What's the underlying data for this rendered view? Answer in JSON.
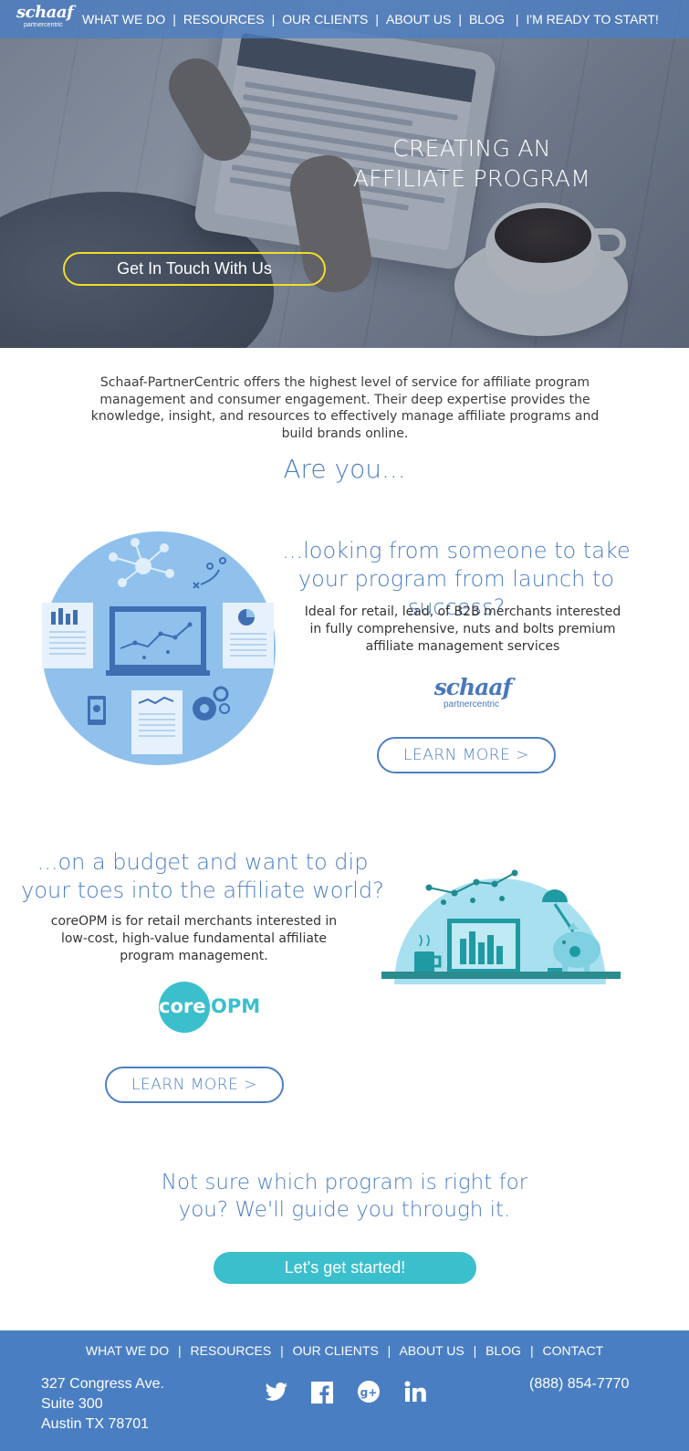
{
  "nav": {
    "logo_word": "schaaf",
    "logo_sub": "partnercentric",
    "items": [
      "WHAT WE DO",
      "RESOURCES",
      "OUR CLIENTS",
      "ABOUT US",
      "BLOG",
      "I'M READY TO START!"
    ]
  },
  "hero": {
    "title_line1": "CREATING AN",
    "title_line2": "AFFILIATE PROGRAM",
    "cta": "Get In Touch With Us"
  },
  "intro": {
    "text": "Schaaf-PartnerCentric offers the highest level of service for affiliate program management and consumer engagement. Their deep expertise provides the knowledge, insight, and resources to effectively manage affiliate programs and build brands online.",
    "are_you": "Are you..."
  },
  "section1": {
    "heading": "...looking from someone to take your program from launch to success?",
    "body": "Ideal for retail, lead, of B2B merchants interested in fully comprehensive, nuts and bolts premium affiliate management services",
    "logo_word": "schaaf",
    "logo_sub": "partnercentric",
    "button": "LEARN MORE >"
  },
  "section2": {
    "heading": "...on a budget and want to dip your toes into the affiliate world?",
    "body": "coreOPM is for retail merchants interested in low-cost, high-value fundamental affiliate program management.",
    "logo_core": "core",
    "logo_opm": "OPM",
    "button": "LEARN MORE >"
  },
  "guide": {
    "heading": "Not sure which program is right for you? We'll guide you through it.",
    "button": "Let's get started!"
  },
  "footer": {
    "nav": [
      "WHAT WE DO",
      "RESOURCES",
      "OUR CLIENTS",
      "ABOUT US",
      "BLOG",
      "CONTACT"
    ],
    "address": [
      "327 Congress Ave.",
      "Suite 300",
      "Austin TX 78701"
    ],
    "phone": "(888) 854-7770",
    "socials": [
      "twitter-icon",
      "facebook-icon",
      "google-plus-icon",
      "linkedin-icon"
    ]
  },
  "colors": {
    "brand_blue": "#4d7fc3",
    "nav_blue": "#4a7ec3",
    "teal": "#3bbfcc",
    "cta_yellow": "#f1dd2b"
  }
}
